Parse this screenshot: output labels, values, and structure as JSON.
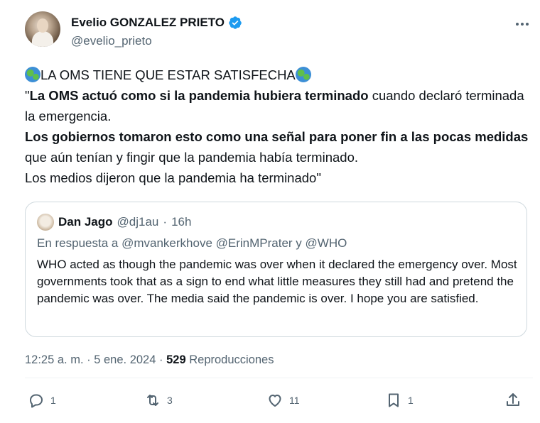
{
  "author": {
    "name": "Evelio GONZALEZ PRIETO",
    "handle": "@evelio_prieto"
  },
  "tweet": {
    "line1": "LA OMS TIENE QUE ESTAR SATISFECHA",
    "quote_open": "\"",
    "bold1": "La OMS actuó como si la pandemia hubiera terminado",
    "text1": " cuando declaró terminada la emergencia.",
    "bold2": "Los gobiernos tomaron esto como una señal para poner fin a las pocas medidas",
    "text2": " que aún tenían y fingir que la pandemia había terminado.",
    "text3": "Los medios dijeron que la pandemia ha terminado\""
  },
  "quoted_tweet": {
    "name": "Dan Jago",
    "handle": "@dj1au",
    "separator": "·",
    "time": "16h",
    "reply_prefix": "En respuesta a",
    "mentions": "@mvankerkhove @ErinMPrater y @WHO",
    "body": "WHO acted as though the pandemic was over when it declared the emergency over. Most governments took that as a sign to end what little measures they still had and pretend the pandemic was over. The media said the pandemic is over.  I hope you are satisfied."
  },
  "meta": {
    "time": "12:25 a. m.",
    "sep1": "·",
    "date": "5 ene. 2024",
    "sep2": "·",
    "views": "529",
    "views_label": "Reproducciones"
  },
  "actions": {
    "replies": "1",
    "retweets": "3",
    "likes": "11",
    "bookmarks": "1"
  },
  "colors": {
    "verified": "#1d9bf0",
    "secondary_text": "#536471"
  }
}
